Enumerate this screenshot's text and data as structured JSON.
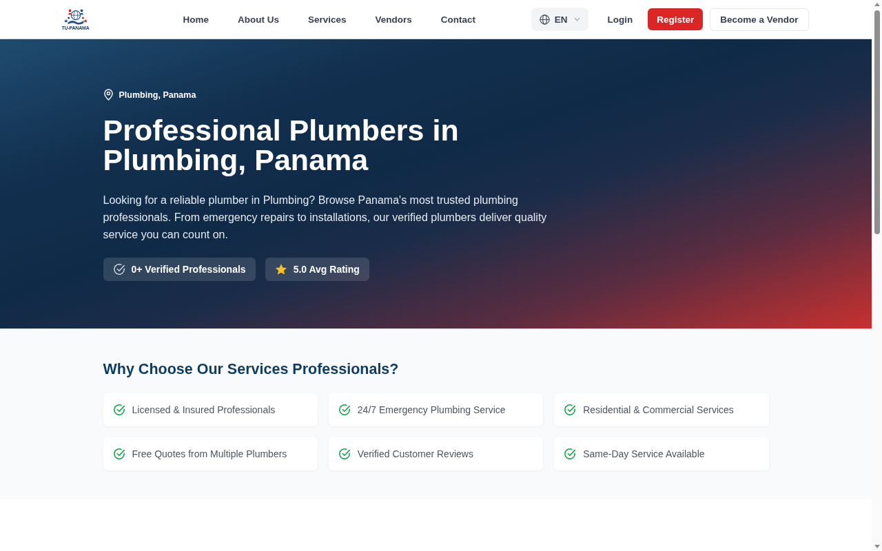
{
  "header": {
    "logo_text": "TU-PANAMA",
    "nav": [
      {
        "label": "Home"
      },
      {
        "label": "About Us"
      },
      {
        "label": "Services"
      },
      {
        "label": "Vendors"
      },
      {
        "label": "Contact"
      }
    ],
    "language": "EN",
    "login": "Login",
    "register": "Register",
    "vendor_button": "Become a Vendor"
  },
  "hero": {
    "location": "Plumbing, Panama",
    "title": "Professional Plumbers in Plumbing, Panama",
    "description": "Looking for a reliable plumber in Plumbing? Browse Panama's most trusted plumbing professionals. From emergency repairs to installations, our verified plumbers deliver quality service you can count on.",
    "badges": [
      {
        "kind": "verified",
        "label": "0+ Verified Professionals"
      },
      {
        "kind": "rating",
        "label": "5.0 Avg Rating"
      }
    ]
  },
  "features": {
    "title": "Why Choose Our Services Professionals?",
    "items": [
      "Licensed & Insured Professionals",
      "24/7 Emergency Plumbing Service",
      "Residential & Commercial Services",
      "Free Quotes from Multiple Plumbers",
      "Verified Customer Reviews",
      "Same-Day Service Available"
    ]
  }
}
